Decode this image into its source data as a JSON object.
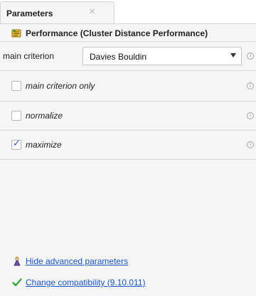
{
  "tabs": [
    {
      "label": "Parameters",
      "close_glyph": "×"
    }
  ],
  "operator": {
    "icon": "performance-icon",
    "title": "Performance (Cluster Distance Performance)"
  },
  "params": {
    "main_criterion": {
      "label": "main criterion",
      "value": "Davies Bouldin"
    },
    "checkboxes": [
      {
        "label": "main criterion only",
        "checked": false
      },
      {
        "label": "normalize",
        "checked": false
      },
      {
        "label": "maximize",
        "checked": true
      }
    ]
  },
  "footer": {
    "hide_advanced": "Hide advanced parameters",
    "change_compat": "Change compatibility (9.10.011)"
  },
  "colors": {
    "link": "#1a56c8",
    "check": "#2f5fbf",
    "compat_check": "#3aa53a"
  }
}
